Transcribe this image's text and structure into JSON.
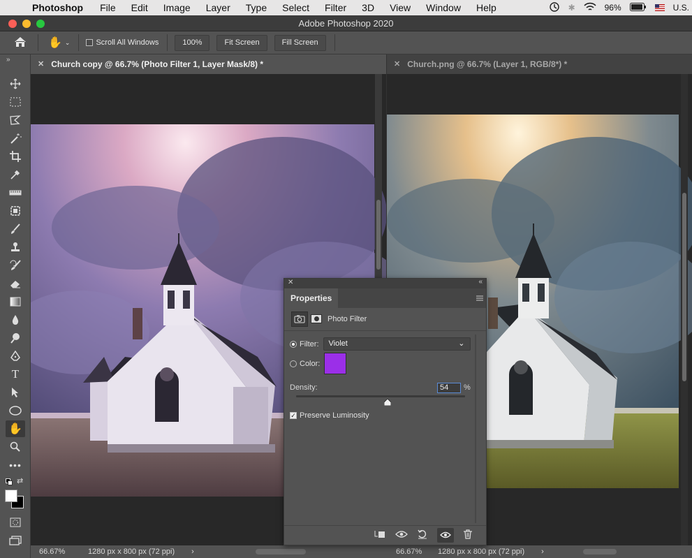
{
  "menubar": {
    "app": "Photoshop",
    "items": [
      "File",
      "Edit",
      "Image",
      "Layer",
      "Type",
      "Select",
      "Filter",
      "3D",
      "View",
      "Window",
      "Help"
    ],
    "battery": "96%",
    "locale": "U.S."
  },
  "window": {
    "title": "Adobe Photoshop 2020"
  },
  "options": {
    "scroll_all_label": "Scroll All Windows",
    "zoom_btn": "100%",
    "fit_screen": "Fit Screen",
    "fill_screen": "Fill Screen"
  },
  "docs": [
    {
      "tab": "Church copy @ 66.7% (Photo Filter 1, Layer Mask/8) *",
      "zoom": "66.67%",
      "size": "1280 px x 800 px (72 ppi)"
    },
    {
      "tab": "Church.png @ 66.7% (Layer 1, RGB/8*) *",
      "zoom": "66.67%",
      "size": "1280 px x 800 px (72 ppi)"
    }
  ],
  "properties": {
    "tab": "Properties",
    "adjustment": "Photo Filter",
    "filter_label": "Filter:",
    "filter_value": "Violet",
    "color_label": "Color:",
    "color_value": "#9b2fe8",
    "density_label": "Density:",
    "density_value": "54",
    "density_unit": "%",
    "density_level": 0.54,
    "preserve_label": "Preserve Luminosity"
  },
  "colors": {
    "foreground": "#ffffff",
    "background": "#000000"
  }
}
